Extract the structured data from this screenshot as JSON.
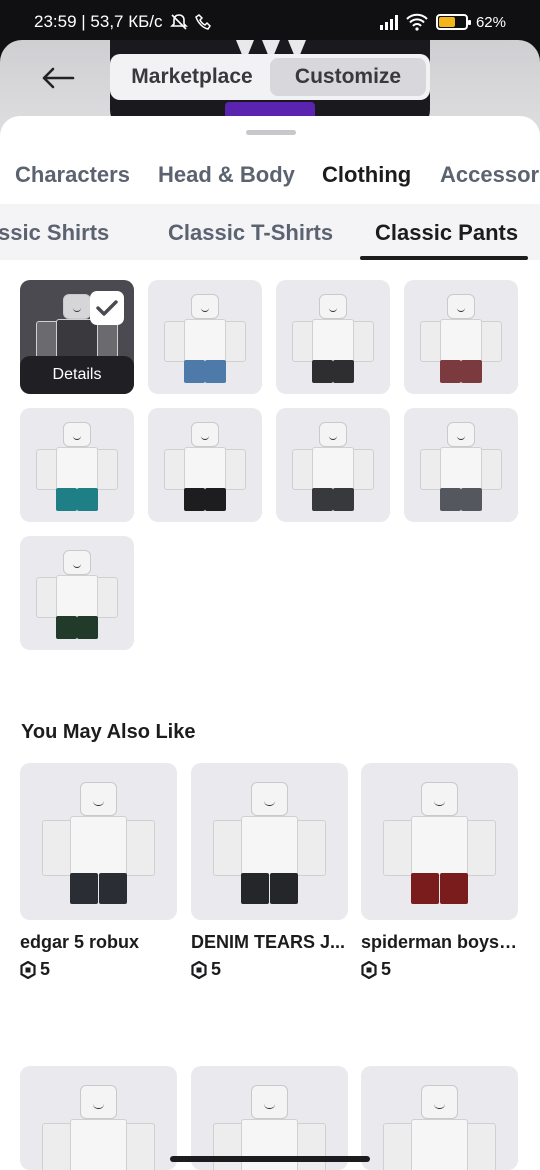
{
  "status_bar": {
    "time_info": "23:59 | 53,7 КБ/с",
    "battery": "62%",
    "battery_level": 0.62
  },
  "header": {
    "segments": [
      {
        "label": "Marketplace",
        "active": false
      },
      {
        "label": "Customize",
        "active": true
      }
    ]
  },
  "category_tabs": [
    {
      "label": "Characters",
      "active": false
    },
    {
      "label": "Head & Body",
      "active": false
    },
    {
      "label": "Clothing",
      "active": true
    },
    {
      "label": "Accessori",
      "active": false
    }
  ],
  "sub_tabs": [
    {
      "label": "ssic Shirts",
      "active": false
    },
    {
      "label": "Classic T-Shirts",
      "active": false
    },
    {
      "label": "Classic Pants",
      "active": true
    }
  ],
  "items": [
    {
      "selected": true,
      "details_label": "Details",
      "pants_color": "#3a2248"
    },
    {
      "selected": false,
      "pants_color": "#4d7aa8"
    },
    {
      "selected": false,
      "pants_color": "#2e2e31"
    },
    {
      "selected": false,
      "pants_color": "#7a3a3e"
    },
    {
      "selected": false,
      "pants_color": "#1f7f86"
    },
    {
      "selected": false,
      "pants_color": "#1d1d1f"
    },
    {
      "selected": false,
      "pants_color": "#38393c"
    },
    {
      "selected": false,
      "pants_color": "#54575e"
    },
    {
      "selected": false,
      "pants_color": "#213a2a"
    }
  ],
  "recommendations": {
    "title": "You May Also Like",
    "cards": [
      {
        "name": "edgar 5 robux",
        "price": "5",
        "pants_color": "#2a2d33"
      },
      {
        "name": "DENIM TEARS J...",
        "price": "5",
        "pants_color": "#25262a"
      },
      {
        "name": "spiderman boys ...",
        "price": "5",
        "pants_color": "#7a1c1c"
      }
    ]
  },
  "icons": {
    "back": "arrow-left-icon",
    "check": "checkmark-icon",
    "robux": "robux-icon"
  }
}
